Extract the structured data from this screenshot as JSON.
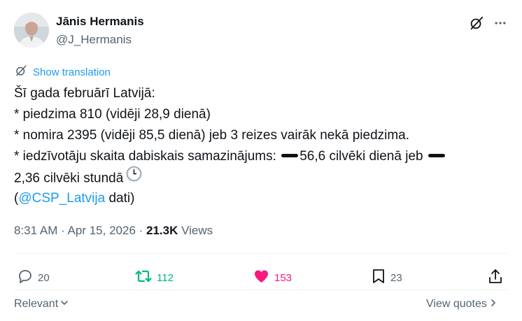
{
  "author": {
    "name": "Jānis Hermanis",
    "handle": "@J_Hermanis"
  },
  "header_icons": [
    "grok-icon",
    "more-icon"
  ],
  "translation_link": "Show translation",
  "tweet": {
    "line1": "Šī gada februārī Latvijā:",
    "line2": "* piedzima 810 (vidēji 28,9 dienā)",
    "line3": "* nomira 2395 (vidēji 85,5 dienā) jeb 3 reizes vairāk nekā piedzima.",
    "line4_a": "* iedzīvotāju skaita dabiskais samazinājums:",
    "line4_b": "56,6 cilvēki dienā jeb",
    "line5": "2,36 cilvēki stundā",
    "line6_open": "(",
    "mention": "@CSP_Latvija",
    "line6_close": " dati)"
  },
  "meta": {
    "time": "8:31 AM",
    "sep1": " · ",
    "date": "Apr 15, 2026",
    "sep2": " · ",
    "views_count": "21.3K",
    "views_label": " Views"
  },
  "actions": {
    "replies": "20",
    "reposts": "112",
    "likes": "153",
    "bookmarks": "23"
  },
  "colors": {
    "accent": "#1d9bf0",
    "repost": "#00ba7c",
    "like": "#f91880",
    "muted": "#536471"
  },
  "footer": {
    "sort_label": "Relevant",
    "view_quotes": "View quotes"
  }
}
